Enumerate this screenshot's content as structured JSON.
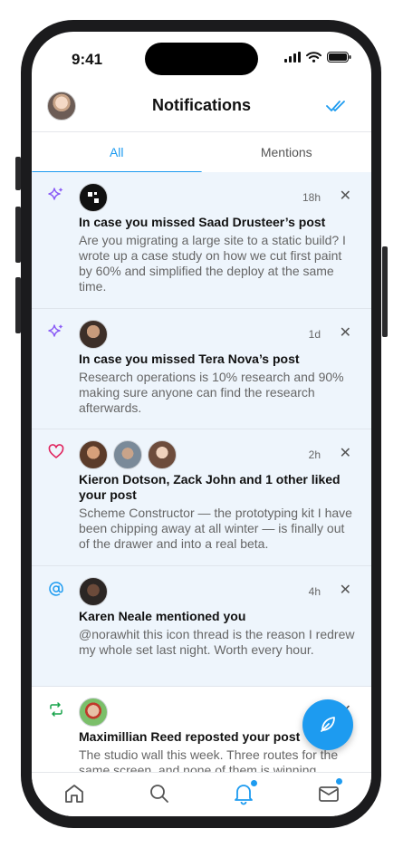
{
  "status": {
    "time": "9:41"
  },
  "header": {
    "title": "Notifications"
  },
  "tabs": [
    {
      "label": "All",
      "active": true
    },
    {
      "label": "Mentions",
      "active": false
    }
  ],
  "notifications": [
    {
      "kind": "sparkle-icon",
      "time": "18h",
      "title": "In case you missed Saad Drusteer’s post",
      "body": "Are you migrating a large site to a static build? I wrote up a case study on how we cut first paint by 60% and simplified the deploy at the same time.",
      "unread": true
    },
    {
      "kind": "sparkle-icon",
      "time": "1d",
      "title": "In case you missed Tera Nova’s post",
      "body": "Research operations is 10% research and 90% making sure anyone can find the research afterwards.",
      "unread": true
    },
    {
      "kind": "heart-icon",
      "time": "2h",
      "title": "Kieron Dotson, Zack John and 1 other liked your post",
      "body": "Scheme Constructor — the prototyping kit I have been chipping away at all winter — is finally out of the drawer and into a real beta.",
      "unread": true
    },
    {
      "kind": "at-icon",
      "time": "4h",
      "title": "Karen Neale mentioned you",
      "body": "@norawhit this icon thread is the reason I redrew my whole set last night. Worth every hour.",
      "unread": true
    },
    {
      "kind": "repost-icon",
      "time": "",
      "title": "Maximillian Reed reposted your post",
      "body": "The studio wall this week. Three routes for the same screen, and none of them is winning.",
      "unread": false
    }
  ],
  "colors": {
    "accent": "#1d9bf0",
    "heart": "#e0245e",
    "sparkle": "#8b5cf6",
    "repost": "#17a34a"
  }
}
